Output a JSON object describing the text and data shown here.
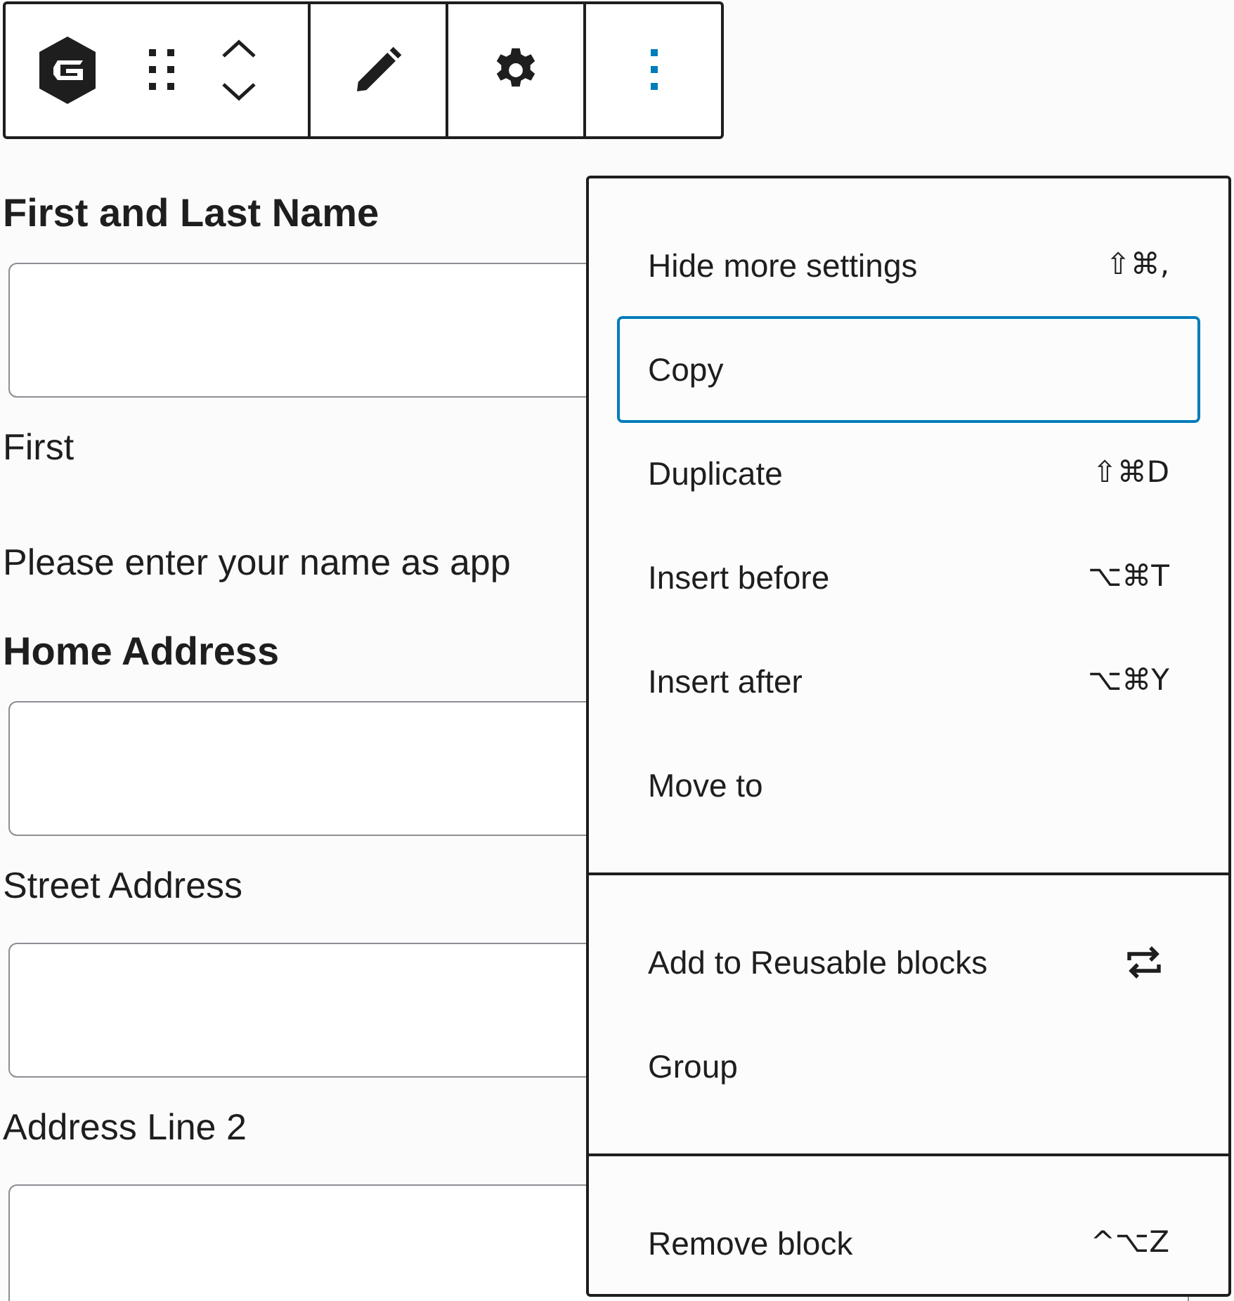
{
  "toolbar": {
    "more_pressed": true
  },
  "form": [
    {
      "kind": "label",
      "text": "First and Last Name"
    },
    {
      "kind": "field"
    },
    {
      "kind": "sublabel",
      "text": "First"
    },
    {
      "kind": "description",
      "text": "Please enter your name as app"
    },
    {
      "kind": "label",
      "text": "Home Address"
    },
    {
      "kind": "field"
    },
    {
      "kind": "sublabel",
      "text": "Street Address"
    },
    {
      "kind": "field"
    },
    {
      "kind": "sublabel",
      "text": "Address Line 2"
    },
    {
      "kind": "field"
    }
  ],
  "menu": {
    "groups": [
      [
        {
          "label": "Hide more settings",
          "kind": "shortcut",
          "shortcut": "⇧⌘,",
          "selected": false
        },
        {
          "label": "Copy",
          "kind": "plain",
          "selected": true
        },
        {
          "label": "Duplicate",
          "kind": "shortcut",
          "shortcut": "⇧⌘D",
          "selected": false
        },
        {
          "label": "Insert before",
          "kind": "shortcut",
          "shortcut": "⌥⌘T",
          "selected": false
        },
        {
          "label": "Insert after",
          "kind": "shortcut",
          "shortcut": "⌥⌘Y",
          "selected": false
        },
        {
          "label": "Move to",
          "kind": "plain",
          "selected": false
        }
      ],
      [
        {
          "label": "Add to Reusable blocks",
          "kind": "icon",
          "selected": false
        },
        {
          "label": "Group",
          "kind": "plain",
          "selected": false
        }
      ],
      [
        {
          "label": "Remove block",
          "kind": "shortcut",
          "shortcut": "^⌥Z",
          "selected": false
        }
      ]
    ]
  }
}
